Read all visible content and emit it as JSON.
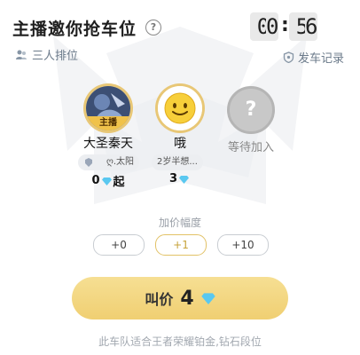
{
  "header": {
    "title": "主播邀你抢车位",
    "help_icon": "question-circle-icon",
    "timer": {
      "d1": "0",
      "d2": "0",
      "d3": "5",
      "d4": "6"
    }
  },
  "mode": {
    "label": "三人排位",
    "icon": "people-icon"
  },
  "records": {
    "label": "发车记录",
    "icon": "shield-icon"
  },
  "seats": [
    {
      "name": "大圣秦天",
      "host_tag": "主播",
      "badge": "ღ.太阳",
      "bid_amount": "0",
      "bid_suffix": "起"
    },
    {
      "name": "哦",
      "badge": "2岁半想...",
      "bid_amount": "3",
      "bid_suffix": ""
    },
    {
      "name": "等待加入",
      "placeholder": "?"
    }
  ],
  "increment": {
    "label": "加价幅度",
    "options": [
      "+0",
      "+1",
      "+10"
    ],
    "selected": "+1"
  },
  "call_button": {
    "label": "叫价",
    "amount": "4"
  },
  "footer": "此车队适合王者荣耀铂金,钻石段位",
  "colors": {
    "gold": "#f0cf72",
    "diamond": "#5ac8f0",
    "accent": "#c7a33b"
  }
}
